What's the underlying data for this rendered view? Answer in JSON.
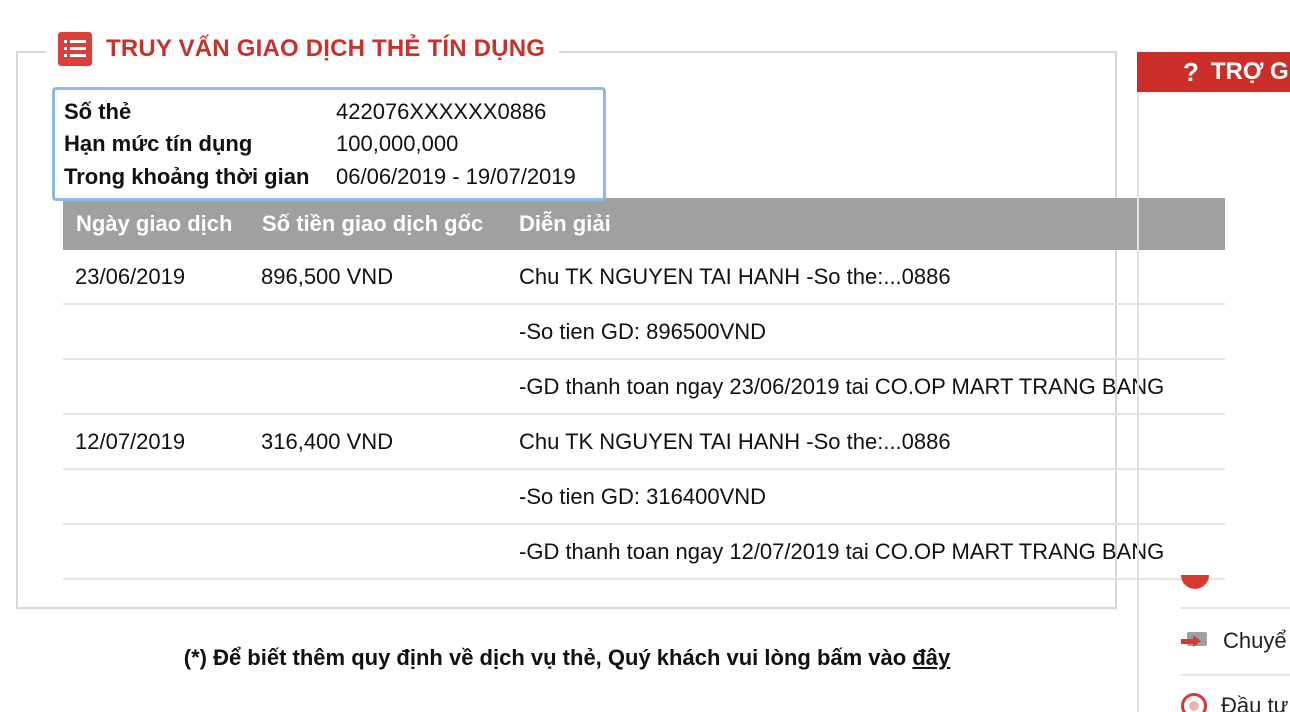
{
  "section": {
    "title": "TRUY VẤN GIAO DỊCH THẺ TÍN DỤNG",
    "icon": "list-icon",
    "accent_color": "#c8312c"
  },
  "info": {
    "card_label": "Số thẻ",
    "card_value": "422076XXXXXX0886",
    "limit_label": "Hạn mức tín dụng",
    "limit_value": "100,000,000",
    "period_label": "Trong khoảng thời gian",
    "period_value": "06/06/2019 - 19/07/2019"
  },
  "table": {
    "headers": [
      "Ngày giao dịch",
      "Số tiền giao dịch gốc",
      "Diễn giải"
    ],
    "rows": [
      {
        "date": "23/06/2019",
        "amount": "896,500 VND",
        "desc": "Chu TK NGUYEN TAI HANH -So the:...0886"
      },
      {
        "date": "",
        "amount": "",
        "desc": "-So tien GD: 896500VND"
      },
      {
        "date": "",
        "amount": "",
        "desc": "-GD thanh toan ngay 23/06/2019 tai CO.OP MART TRANG BANG"
      },
      {
        "date": "12/07/2019",
        "amount": "316,400 VND",
        "desc": "Chu TK NGUYEN TAI HANH -So the:...0886"
      },
      {
        "date": "",
        "amount": "",
        "desc": "-So tien GD: 316400VND"
      },
      {
        "date": "",
        "amount": "",
        "desc": "-GD thanh toan ngay 12/07/2019 tai CO.OP MART TRANG BANG"
      }
    ]
  },
  "sidebar": {
    "header": "TRỢ G",
    "header_icon": "help-icon",
    "items": [
      {
        "label": "Chuyể",
        "icon": "transfer-icon"
      },
      {
        "label": "Đầu tư",
        "icon": "invest-icon"
      }
    ]
  },
  "footer": {
    "note": "(*) Để biết thêm quy định về dịch vụ thẻ, Quý khách vui lòng bấm vào ",
    "link": "đây"
  }
}
